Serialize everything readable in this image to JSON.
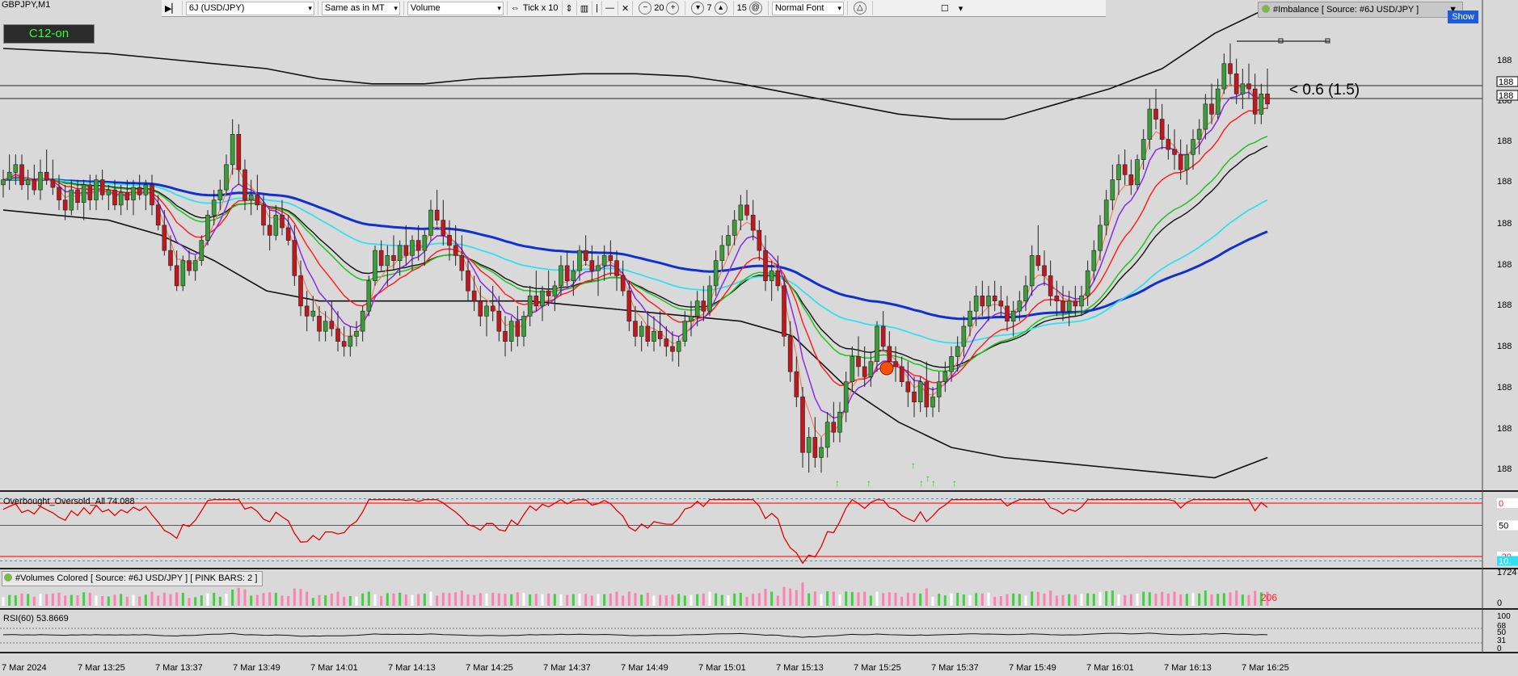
{
  "symbol_label": "GBPJPY,M1",
  "c12_label": "C12-on",
  "toolbar": {
    "symbol": "6J (USD/JPY)",
    "mode": "Same as in MT",
    "type": "Volume",
    "tick": "Tick x 10",
    "v1": "20",
    "v2": "7",
    "v3": "15",
    "font": "Normal Font"
  },
  "imbalance_label": "#Imbalance [ Source: #6J USD/JPY ]",
  "show_label": "Show",
  "imbalance_text": "< 0.6 (1.5)",
  "price_labels": [
    "188",
    "188",
    "188",
    "188",
    "188",
    "188",
    "188",
    "188",
    "188",
    "188",
    "188",
    "188"
  ],
  "osc_label": "Overbought_Oversold_All 74.088",
  "osc_scale": [
    "0",
    "50",
    "-20",
    "10."
  ],
  "volume_label": "#Volumes Colored [ Source: #6J USD/JPY ]  [ PINK BARS: 2 ]",
  "volume_scale": [
    "1724",
    "0"
  ],
  "volume_last": "206",
  "rsi_label": "RSI(60) 53.8669",
  "rsi_scale": [
    "100",
    "68",
    "50",
    "31",
    "0"
  ],
  "time_labels": [
    "7 Mar 2024",
    "7 Mar 13:25",
    "7 Mar 13:37",
    "7 Mar 13:49",
    "7 Mar 14:01",
    "7 Mar 14:13",
    "7 Mar 14:25",
    "7 Mar 14:37",
    "7 Mar 14:49",
    "7 Mar 15:01",
    "7 Mar 15:13",
    "7 Mar 15:25",
    "7 Mar 15:37",
    "7 Mar 15:49",
    "7 Mar 16:01",
    "7 Mar 16:13",
    "7 Mar 16:25"
  ],
  "colors": {
    "bg": "#d9d9d9",
    "bull": "#3a9d3a",
    "bear": "#c0181c",
    "ma_blue": "#1030d0",
    "ma_cyan": "#30e0f0",
    "ma_green": "#20c020",
    "ma_red": "#ff2020",
    "ma_purple": "#8a2be2",
    "ma_salmon": "#f08060",
    "band": "#111111",
    "osc": "#e00000",
    "vol_green": "#40d040",
    "vol_pink": "#ff80b0",
    "vol_white": "#ffffff"
  },
  "chart_data": {
    "type": "candlestick",
    "x_range": [
      "7 Mar 2024 13:13",
      "7 Mar 2024 16:27"
    ],
    "candles": [
      [
        188.5,
        188.56,
        188.45,
        188.52
      ],
      [
        188.52,
        188.62,
        188.48,
        188.55
      ],
      [
        188.55,
        188.62,
        188.5,
        188.58
      ],
      [
        188.58,
        188.62,
        188.48,
        188.5
      ],
      [
        188.5,
        188.56,
        188.44,
        188.52
      ],
      [
        188.52,
        188.58,
        188.46,
        188.48
      ],
      [
        188.48,
        188.6,
        188.44,
        188.55
      ],
      [
        188.55,
        188.64,
        188.5,
        188.52
      ],
      [
        188.52,
        188.6,
        188.46,
        188.49
      ],
      [
        188.49,
        188.54,
        188.4,
        188.44
      ],
      [
        188.44,
        188.5,
        188.36,
        188.4
      ],
      [
        188.4,
        188.52,
        188.38,
        188.48
      ],
      [
        188.48,
        188.52,
        188.4,
        188.43
      ],
      [
        188.43,
        188.52,
        188.36,
        188.5
      ],
      [
        188.5,
        188.54,
        188.4,
        188.44
      ],
      [
        188.44,
        188.54,
        188.4,
        188.52
      ],
      [
        188.52,
        188.56,
        188.44,
        188.46
      ],
      [
        188.46,
        188.5,
        188.4,
        188.48
      ],
      [
        188.48,
        188.52,
        188.4,
        188.42
      ],
      [
        188.42,
        188.5,
        188.38,
        188.47
      ],
      [
        188.47,
        188.52,
        188.4,
        188.44
      ],
      [
        188.44,
        188.52,
        188.38,
        188.49
      ],
      [
        188.49,
        188.54,
        188.44,
        188.46
      ],
      [
        188.46,
        188.52,
        188.4,
        188.5
      ],
      [
        188.5,
        188.54,
        188.38,
        188.42
      ],
      [
        188.42,
        188.46,
        188.32,
        188.34
      ],
      [
        188.34,
        188.4,
        188.22,
        188.24
      ],
      [
        188.24,
        188.3,
        188.16,
        188.18
      ],
      [
        188.18,
        188.24,
        188.08,
        188.1
      ],
      [
        188.1,
        188.22,
        188.08,
        188.2
      ],
      [
        188.2,
        188.24,
        188.14,
        188.16
      ],
      [
        188.16,
        188.22,
        188.12,
        188.2
      ],
      [
        188.2,
        188.3,
        188.18,
        188.28
      ],
      [
        188.28,
        188.4,
        188.26,
        188.38
      ],
      [
        188.38,
        188.48,
        188.34,
        188.44
      ],
      [
        188.44,
        188.52,
        188.4,
        188.48
      ],
      [
        188.48,
        188.62,
        188.46,
        188.58
      ],
      [
        188.58,
        188.76,
        188.54,
        188.7
      ],
      [
        188.7,
        188.74,
        188.5,
        188.56
      ],
      [
        188.56,
        188.6,
        188.4,
        188.44
      ],
      [
        188.44,
        188.52,
        188.38,
        188.46
      ],
      [
        188.46,
        188.54,
        188.4,
        188.42
      ],
      [
        188.42,
        188.46,
        188.3,
        188.34
      ],
      [
        188.34,
        188.4,
        188.24,
        188.3
      ],
      [
        188.3,
        188.42,
        188.28,
        188.38
      ],
      [
        188.38,
        188.44,
        188.3,
        188.33
      ],
      [
        188.33,
        188.38,
        188.26,
        188.28
      ],
      [
        188.28,
        188.34,
        188.1,
        188.14
      ],
      [
        188.14,
        188.2,
        187.98,
        188.02
      ],
      [
        188.02,
        188.08,
        187.92,
        187.98
      ],
      [
        187.98,
        188.06,
        187.96,
        188.0
      ],
      [
        187.98,
        188.02,
        187.88,
        187.92
      ],
      [
        187.92,
        188.0,
        187.88,
        187.96
      ],
      [
        187.96,
        188.04,
        187.9,
        187.93
      ],
      [
        187.93,
        188.0,
        187.84,
        187.88
      ],
      [
        187.88,
        187.94,
        187.82,
        187.86
      ],
      [
        187.86,
        187.94,
        187.82,
        187.9
      ],
      [
        187.9,
        187.96,
        187.86,
        187.92
      ],
      [
        187.92,
        188.02,
        187.88,
        188.0
      ],
      [
        188.0,
        188.14,
        187.98,
        188.12
      ],
      [
        188.12,
        188.26,
        188.1,
        188.24
      ],
      [
        188.24,
        188.28,
        188.16,
        188.18
      ],
      [
        188.18,
        188.26,
        188.1,
        188.22
      ],
      [
        188.22,
        188.3,
        188.16,
        188.2
      ],
      [
        188.2,
        188.28,
        188.14,
        188.26
      ],
      [
        188.26,
        188.34,
        188.18,
        188.22
      ],
      [
        188.22,
        188.3,
        188.16,
        188.28
      ],
      [
        188.28,
        188.34,
        188.2,
        188.24
      ],
      [
        188.24,
        188.32,
        188.18,
        188.3
      ],
      [
        188.3,
        188.44,
        188.28,
        188.4
      ],
      [
        188.4,
        188.48,
        188.34,
        188.36
      ],
      [
        188.36,
        188.44,
        188.26,
        188.3
      ],
      [
        188.3,
        188.36,
        188.2,
        188.26
      ],
      [
        188.26,
        188.34,
        188.18,
        188.22
      ],
      [
        188.22,
        188.3,
        188.12,
        188.16
      ],
      [
        188.16,
        188.2,
        188.04,
        188.08
      ],
      [
        188.08,
        188.14,
        188.0,
        188.04
      ],
      [
        188.04,
        188.1,
        187.94,
        187.98
      ],
      [
        187.98,
        188.04,
        187.9,
        188.02
      ],
      [
        188.02,
        188.1,
        187.96,
        188.0
      ],
      [
        188.0,
        188.06,
        187.88,
        187.92
      ],
      [
        187.92,
        187.98,
        187.82,
        187.88
      ],
      [
        187.88,
        187.98,
        187.84,
        187.96
      ],
      [
        187.96,
        188.02,
        187.86,
        187.9
      ],
      [
        187.9,
        188.0,
        187.86,
        187.98
      ],
      [
        187.98,
        188.1,
        187.94,
        188.06
      ],
      [
        188.06,
        188.16,
        188.0,
        188.02
      ],
      [
        188.02,
        188.1,
        187.96,
        188.08
      ],
      [
        188.08,
        188.16,
        188.02,
        188.06
      ],
      [
        188.06,
        188.12,
        188.0,
        188.1
      ],
      [
        188.1,
        188.22,
        188.06,
        188.18
      ],
      [
        188.18,
        188.24,
        188.1,
        188.12
      ],
      [
        188.12,
        188.2,
        188.06,
        188.16
      ],
      [
        188.16,
        188.26,
        188.12,
        188.24
      ],
      [
        188.24,
        188.3,
        188.18,
        188.2
      ],
      [
        188.2,
        188.26,
        188.12,
        188.16
      ],
      [
        188.16,
        188.22,
        188.06,
        188.18
      ],
      [
        188.18,
        188.26,
        188.12,
        188.22
      ],
      [
        188.22,
        188.28,
        188.14,
        188.2
      ],
      [
        188.2,
        188.24,
        188.08,
        188.14
      ],
      [
        188.14,
        188.2,
        188.06,
        188.08
      ],
      [
        188.08,
        188.12,
        187.92,
        187.96
      ],
      [
        187.96,
        188.02,
        187.86,
        187.9
      ],
      [
        187.9,
        187.96,
        187.84,
        187.94
      ],
      [
        187.94,
        188.0,
        187.86,
        187.88
      ],
      [
        187.88,
        187.98,
        187.84,
        187.92
      ],
      [
        187.92,
        188.0,
        187.86,
        187.89
      ],
      [
        187.89,
        187.94,
        187.82,
        187.86
      ],
      [
        187.86,
        187.92,
        187.8,
        187.84
      ],
      [
        187.84,
        187.9,
        187.78,
        187.88
      ],
      [
        187.88,
        188.0,
        187.86,
        187.96
      ],
      [
        187.96,
        188.04,
        187.9,
        187.98
      ],
      [
        187.98,
        188.08,
        187.94,
        188.04
      ],
      [
        188.04,
        188.1,
        187.96,
        188.0
      ],
      [
        188.0,
        188.14,
        187.98,
        188.1
      ],
      [
        188.1,
        188.24,
        188.06,
        188.2
      ],
      [
        188.2,
        188.3,
        188.16,
        188.26
      ],
      [
        188.26,
        188.34,
        188.22,
        188.3
      ],
      [
        188.3,
        188.4,
        188.26,
        188.36
      ],
      [
        188.36,
        188.46,
        188.32,
        188.42
      ],
      [
        188.42,
        188.48,
        188.36,
        188.38
      ],
      [
        188.38,
        188.44,
        188.28,
        188.32
      ],
      [
        188.32,
        188.36,
        188.2,
        188.24
      ],
      [
        188.24,
        188.3,
        188.08,
        188.12
      ],
      [
        188.12,
        188.2,
        188.04,
        188.16
      ],
      [
        188.16,
        188.22,
        188.08,
        188.1
      ],
      [
        188.1,
        188.14,
        187.86,
        187.9
      ],
      [
        187.9,
        187.96,
        187.72,
        187.76
      ],
      [
        187.76,
        187.82,
        187.62,
        187.66
      ],
      [
        187.66,
        187.7,
        187.38,
        187.44
      ],
      [
        187.44,
        187.54,
        187.36,
        187.5
      ],
      [
        187.5,
        187.58,
        187.38,
        187.42
      ],
      [
        187.42,
        187.5,
        187.36,
        187.46
      ],
      [
        187.46,
        187.6,
        187.42,
        187.56
      ],
      [
        187.56,
        187.64,
        187.48,
        187.52
      ],
      [
        187.52,
        187.64,
        187.48,
        187.6
      ],
      [
        187.6,
        187.76,
        187.56,
        187.72
      ],
      [
        187.72,
        187.86,
        187.68,
        187.82
      ],
      [
        187.82,
        187.9,
        187.74,
        187.78
      ],
      [
        187.78,
        187.86,
        187.7,
        187.74
      ],
      [
        187.74,
        187.84,
        187.7,
        187.8
      ],
      [
        187.8,
        187.96,
        187.76,
        187.94
      ],
      [
        187.94,
        188.0,
        187.84,
        187.86
      ],
      [
        187.86,
        187.92,
        187.76,
        187.8
      ],
      [
        187.8,
        187.86,
        187.72,
        187.78
      ],
      [
        187.78,
        187.82,
        187.7,
        187.72
      ],
      [
        187.72,
        187.8,
        187.62,
        187.68
      ],
      [
        187.68,
        187.74,
        187.58,
        187.64
      ],
      [
        187.64,
        187.74,
        187.6,
        187.72
      ],
      [
        187.72,
        187.8,
        187.58,
        187.62
      ],
      [
        187.62,
        187.7,
        187.58,
        187.66
      ],
      [
        187.66,
        187.76,
        187.6,
        187.72
      ],
      [
        187.72,
        187.8,
        187.68,
        187.76
      ],
      [
        187.76,
        187.86,
        187.72,
        187.82
      ],
      [
        187.82,
        187.9,
        187.76,
        187.86
      ],
      [
        187.86,
        187.98,
        187.82,
        187.94
      ],
      [
        187.94,
        188.04,
        187.9,
        188.0
      ],
      [
        188.0,
        188.1,
        187.94,
        188.06
      ],
      [
        188.06,
        188.12,
        187.98,
        188.02
      ],
      [
        188.02,
        188.1,
        187.96,
        188.06
      ],
      [
        188.06,
        188.12,
        188.0,
        188.04
      ],
      [
        188.04,
        188.1,
        187.98,
        188.02
      ],
      [
        188.02,
        188.06,
        187.92,
        187.96
      ],
      [
        187.96,
        188.04,
        187.9,
        188.0
      ],
      [
        188.0,
        188.08,
        187.96,
        188.04
      ],
      [
        188.04,
        188.14,
        188.0,
        188.1
      ],
      [
        188.1,
        188.26,
        188.06,
        188.22
      ],
      [
        188.22,
        188.34,
        188.16,
        188.18
      ],
      [
        188.18,
        188.24,
        188.1,
        188.14
      ],
      [
        188.14,
        188.2,
        188.02,
        188.06
      ],
      [
        188.06,
        188.12,
        187.98,
        188.04
      ],
      [
        188.04,
        188.1,
        187.96,
        188.0
      ],
      [
        188.0,
        188.08,
        187.94,
        188.04
      ],
      [
        188.04,
        188.1,
        187.98,
        188.02
      ],
      [
        188.02,
        188.1,
        187.98,
        188.06
      ],
      [
        188.06,
        188.2,
        188.02,
        188.16
      ],
      [
        188.16,
        188.28,
        188.12,
        188.24
      ],
      [
        188.24,
        188.38,
        188.2,
        188.34
      ],
      [
        188.34,
        188.48,
        188.3,
        188.44
      ],
      [
        188.44,
        188.58,
        188.4,
        188.52
      ],
      [
        188.52,
        188.62,
        188.46,
        188.58
      ],
      [
        188.58,
        188.64,
        188.5,
        188.54
      ],
      [
        188.54,
        188.6,
        188.46,
        188.5
      ],
      [
        188.5,
        188.62,
        188.48,
        188.6
      ],
      [
        188.6,
        188.72,
        188.56,
        188.68
      ],
      [
        188.68,
        188.84,
        188.64,
        188.8
      ],
      [
        188.8,
        188.88,
        188.72,
        188.76
      ],
      [
        188.76,
        188.82,
        188.64,
        188.68
      ],
      [
        188.68,
        188.74,
        188.6,
        188.64
      ],
      [
        188.64,
        188.72,
        188.56,
        188.62
      ],
      [
        188.62,
        188.68,
        188.52,
        188.56
      ],
      [
        188.56,
        188.66,
        188.5,
        188.62
      ],
      [
        188.62,
        188.72,
        188.56,
        188.68
      ],
      [
        188.68,
        188.76,
        188.62,
        188.72
      ],
      [
        188.72,
        188.86,
        188.68,
        188.82
      ],
      [
        188.82,
        188.9,
        188.74,
        188.78
      ],
      [
        188.78,
        188.92,
        188.76,
        188.88
      ],
      [
        188.88,
        189.02,
        188.86,
        188.98
      ],
      [
        188.98,
        189.06,
        188.9,
        188.94
      ],
      [
        188.94,
        189.0,
        188.82,
        188.86
      ],
      [
        188.86,
        188.96,
        188.8,
        188.9
      ],
      [
        188.9,
        188.98,
        188.84,
        188.88
      ],
      [
        188.88,
        188.94,
        188.74,
        188.78
      ],
      [
        188.78,
        188.9,
        188.74,
        188.86
      ],
      [
        188.86,
        188.96,
        188.8,
        188.82
      ]
    ],
    "bands": {
      "upper": [
        189.04,
        189.03,
        189.02,
        189.0,
        188.98,
        188.96,
        188.92,
        188.9,
        188.9,
        188.92,
        188.93,
        188.94,
        188.94,
        188.93,
        188.9,
        188.86,
        188.82,
        188.78,
        188.76,
        188.76,
        188.82,
        188.88,
        188.96,
        189.1,
        189.2
      ],
      "lower": [
        188.4,
        188.38,
        188.36,
        188.3,
        188.2,
        188.08,
        188.04,
        188.04,
        188.04,
        188.04,
        188.04,
        188.02,
        188.0,
        187.98,
        187.96,
        187.9,
        187.7,
        187.56,
        187.46,
        187.42,
        187.4,
        187.38,
        187.36,
        187.34,
        187.42
      ]
    }
  }
}
